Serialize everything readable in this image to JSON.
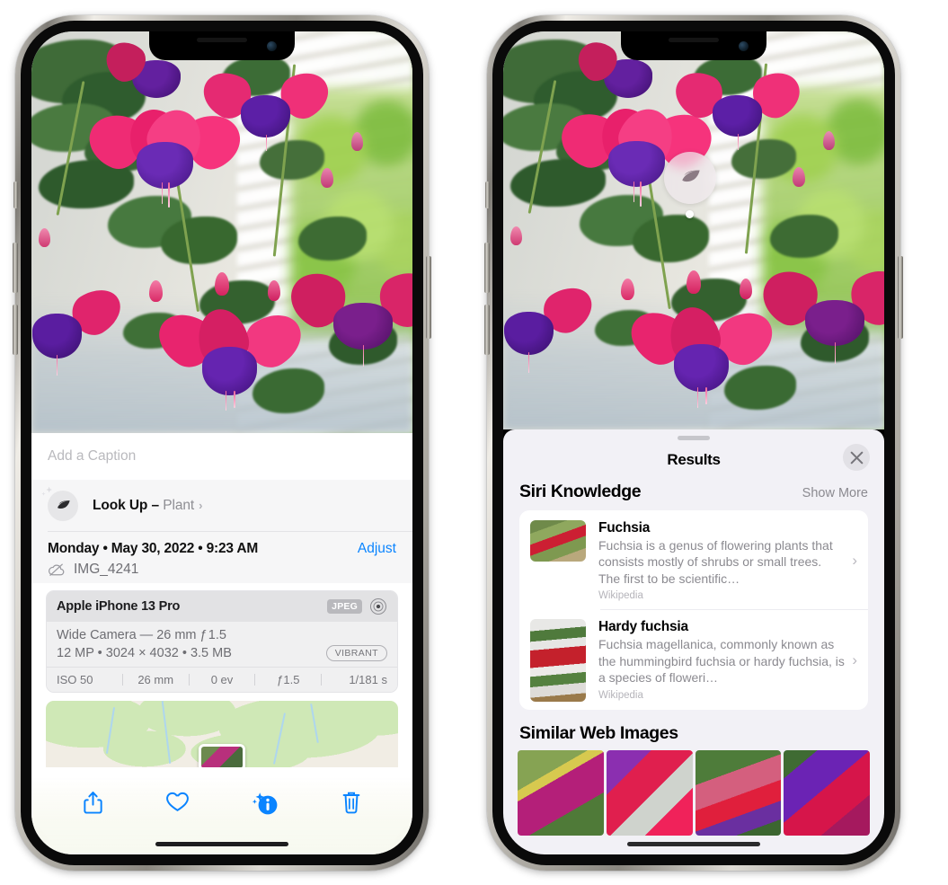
{
  "left_phone": {
    "caption_placeholder": "Add a Caption",
    "lookup": {
      "label": "Look Up –",
      "subject": "Plant",
      "chevron": "›",
      "icon": "leaf-icon"
    },
    "metadata": {
      "date": "Monday • May 30, 2022 • 9:23 AM",
      "adjust_label": "Adjust",
      "filename": "IMG_4241",
      "cloud_icon": "icloud-slash-icon"
    },
    "exif": {
      "device": "Apple iPhone 13 Pro",
      "format_badge": "JPEG",
      "aperture_icon": "lens-icon",
      "lens": "Wide Camera — 26 mm ƒ 1.5",
      "size": "12 MP • 3024 × 4032 • 3.5 MB",
      "style_badge": "VIBRANT",
      "stats": [
        "ISO 50",
        "26 mm",
        "0 ev",
        "ƒ1.5",
        "1/181 s"
      ]
    },
    "toolbar": [
      {
        "name": "share-button",
        "icon": "share-icon"
      },
      {
        "name": "favorite-button",
        "icon": "heart-icon"
      },
      {
        "name": "info-button",
        "icon": "info-sparkle-icon"
      },
      {
        "name": "delete-button",
        "icon": "trash-icon"
      }
    ],
    "accent_color": "#0a84ff"
  },
  "right_phone": {
    "visual_lookup_marker": {
      "icon": "leaf-icon"
    },
    "sheet": {
      "title": "Results",
      "close_icon": "close-icon",
      "sections": [
        {
          "title": "Siri Knowledge",
          "action_label": "Show More",
          "cards": [
            {
              "title": "Fuchsia",
              "description": "Fuchsia is a genus of flowering plants that consists mostly of shrubs or small trees. The first to be scientific…",
              "source": "Wikipedia",
              "chevron": "›"
            },
            {
              "title": "Hardy fuchsia",
              "description": "Fuchsia magellanica, commonly known as the hummingbird fuchsia or hardy fuchsia, is a species of floweri…",
              "source": "Wikipedia",
              "chevron": "›"
            }
          ]
        },
        {
          "title": "Similar Web Images",
          "image_count": 4
        }
      ]
    }
  },
  "colors": {
    "accent": "#0a84ff",
    "sheet_bg": "#f2f1f6",
    "card_bg": "#ffffff",
    "secondary_text": "#8b8a90"
  }
}
